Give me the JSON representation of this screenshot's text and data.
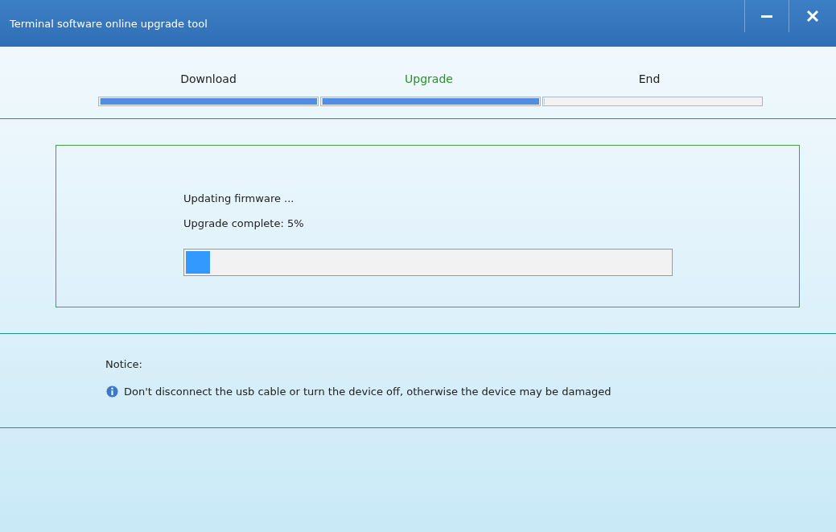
{
  "window": {
    "title": "Terminal software online upgrade tool"
  },
  "steps": [
    {
      "label": "Download",
      "selected": false,
      "level": 1
    },
    {
      "label": "Upgrade",
      "selected": true,
      "level": 1
    },
    {
      "label": "End",
      "selected": false,
      "level": 0
    }
  ],
  "status": {
    "message": "Updating firmware ...",
    "progress_text": "Upgrade complete: 5%",
    "level": 0.05
  },
  "notice": {
    "title": "Notice:",
    "message": "Don't disconnect the usb cable or turn the device off, otherwise the device may be damaged"
  }
}
